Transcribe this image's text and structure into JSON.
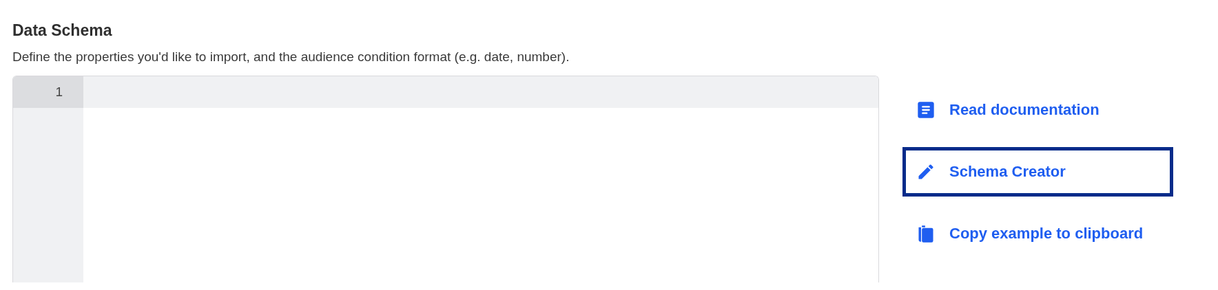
{
  "section": {
    "title": "Data Schema",
    "description": "Define the properties you'd like to import, and the audience condition format (e.g. date, number)."
  },
  "editor": {
    "lines": [
      {
        "number": "1",
        "active": true
      }
    ]
  },
  "links": [
    {
      "kind": "document",
      "label": "Read documentation",
      "focused": false
    },
    {
      "kind": "pencil",
      "label": "Schema Creator",
      "focused": true
    },
    {
      "kind": "copy",
      "label": "Copy example to clipboard",
      "focused": false
    }
  ]
}
